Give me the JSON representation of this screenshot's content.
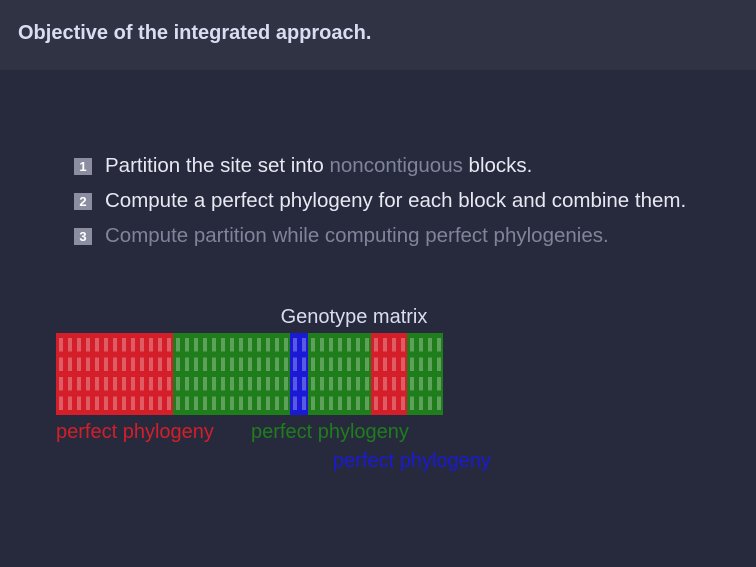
{
  "header": {
    "title": "Objective of the integrated approach."
  },
  "list": [
    {
      "num": "1",
      "before": "Partition the site set into ",
      "highlight": "noncontiguous",
      "after": " blocks."
    },
    {
      "num": "2",
      "text": "Compute a perfect phylogeny for each block and combine them."
    },
    {
      "num": "3",
      "text": "Compute partition while computing perfect phylogenies."
    }
  ],
  "matrix": {
    "title": "Genotype matrix",
    "rows": 4,
    "blocks": [
      {
        "cols": 13,
        "color": "#d41e2a"
      },
      {
        "cols": 13,
        "color": "#1f7d1c"
      },
      {
        "cols": 2,
        "color": "#1a1ad6"
      },
      {
        "cols": 7,
        "color": "#1f7d1c"
      },
      {
        "cols": 4,
        "color": "#d41e2a"
      },
      {
        "cols": 4,
        "color": "#1f7d1c"
      }
    ]
  },
  "labels": {
    "red": "perfect phylogeny",
    "green": "perfect phylogeny",
    "blue": "perfect phylogeny"
  },
  "colors": {
    "red": "#d41e2a",
    "green": "#1f7d1c",
    "blue": "#1a1ad6",
    "background": "#262a3c"
  }
}
